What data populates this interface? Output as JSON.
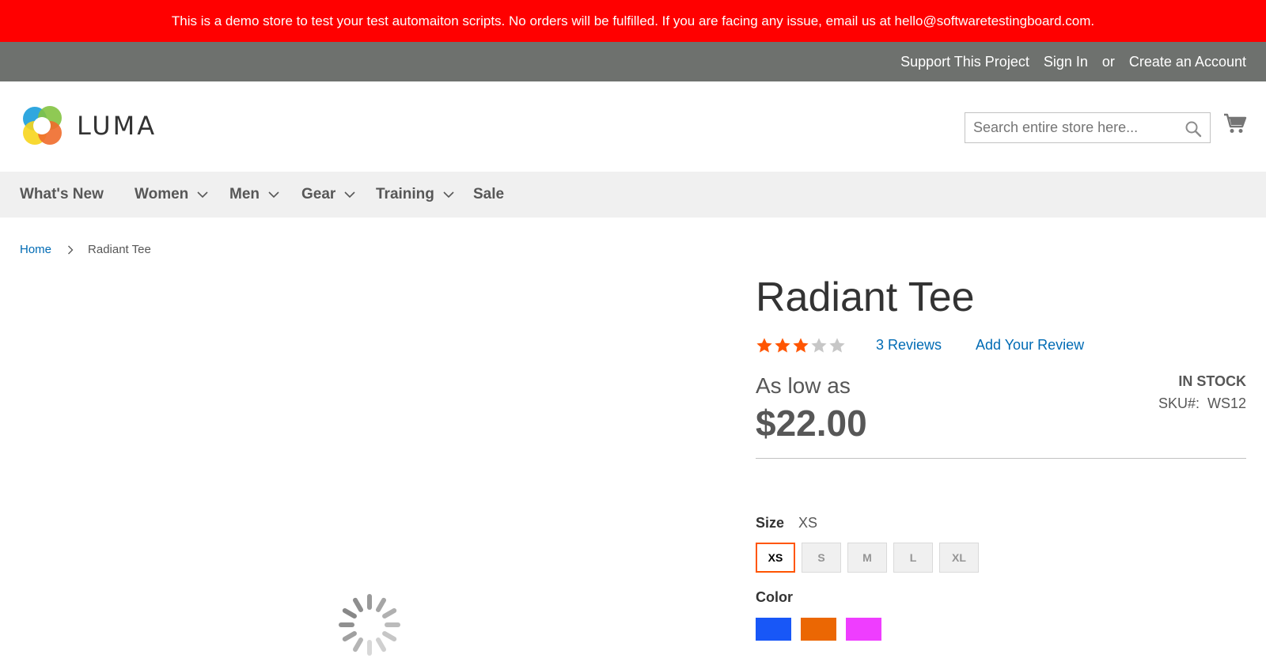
{
  "banner": {
    "text": "This is a demo store to test your test automaiton scripts. No orders will be fulfilled. If you are facing any issue, email us at hello@softwaretestingboard.com."
  },
  "top_links": {
    "support": "Support This Project",
    "sign_in": "Sign In",
    "or": "or",
    "create_account": "Create an Account"
  },
  "header": {
    "logo_text": "LUMA",
    "search_placeholder": "Search entire store here...",
    "search_icon": "search-icon",
    "cart_icon": "cart-icon"
  },
  "nav": {
    "items": [
      {
        "label": "What's New"
      },
      {
        "label": "Women"
      },
      {
        "label": "Men"
      },
      {
        "label": "Gear"
      },
      {
        "label": "Training"
      },
      {
        "label": "Sale"
      }
    ]
  },
  "breadcrumb": {
    "home": "Home",
    "current": "Radiant Tee"
  },
  "product": {
    "name": "Radiant Tee",
    "rating": 3,
    "rating_max": 5,
    "reviews_link": "3  Reviews",
    "add_review": "Add Your Review",
    "price_label": "As low as",
    "price": "$22.00",
    "stock": "IN STOCK",
    "sku_label": "SKU#:",
    "sku": "WS12",
    "size_label": "Size",
    "size_selected": "XS",
    "sizes": [
      "XS",
      "S",
      "M",
      "L",
      "XL"
    ],
    "color_label": "Color",
    "colors": [
      "#1857f7",
      "#eb6703",
      "#ef3dff"
    ]
  },
  "colors": {
    "banner": "#ff0000",
    "topbar": "#6e716e",
    "link": "#006bb4",
    "accent": "#ff5501",
    "star_on": "#ff5501",
    "star_off": "#c7c7c7"
  }
}
